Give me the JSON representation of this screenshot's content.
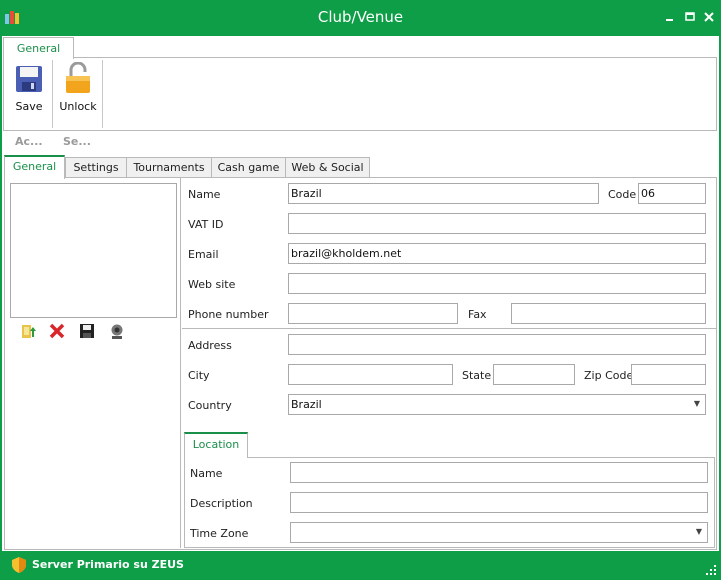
{
  "window": {
    "title": "Club/Venue"
  },
  "ribbon": {
    "tab": "General",
    "save_label": "Save",
    "unlock_label": "Unlock",
    "group_1": "Ac...",
    "group_2": "Se..."
  },
  "tabs": [
    "General",
    "Settings",
    "Tournaments",
    "Cash game",
    "Web & Social"
  ],
  "form": {
    "name_label": "Name",
    "name_value": "Brazil",
    "code_label": "Code",
    "code_value": "06",
    "vat_label": "VAT ID",
    "vat_value": "",
    "email_label": "Email",
    "email_value": "brazil@kholdem.net",
    "website_label": "Web site",
    "website_value": "",
    "phone_label": "Phone number",
    "phone_value": "",
    "fax_label": "Fax",
    "fax_value": "",
    "address_label": "Address",
    "address_value": "",
    "city_label": "City",
    "city_value": "",
    "state_label": "State",
    "state_value": "",
    "zip_label": "Zip Code",
    "zip_value": "",
    "country_label": "Country",
    "country_value": "Brazil"
  },
  "location": {
    "tab": "Location",
    "name_label": "Name",
    "name_value": "",
    "description_label": "Description",
    "description_value": "",
    "timezone_label": "Time Zone",
    "timezone_value": ""
  },
  "image_tools": [
    "load-image-icon",
    "delete-icon",
    "save-disk-icon",
    "webcam-icon"
  ],
  "status": {
    "text": "Server Primario su ZEUS"
  },
  "colors": {
    "accent": "#0e9e47",
    "tab_text": "#1a8f4a"
  }
}
